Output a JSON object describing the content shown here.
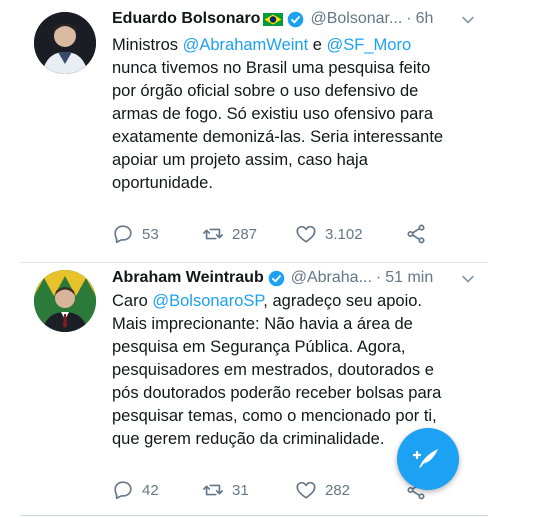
{
  "tweets": [
    {
      "name": "Eduardo Bolsonaro",
      "handle": "@Bolsonar...",
      "dot": "·",
      "time": "6h",
      "text_parts": [
        {
          "t": "Ministros "
        },
        {
          "t": "@AbrahamWeint",
          "mention": true
        },
        {
          "t": " e "
        },
        {
          "t": "@SF_Moro",
          "mention": true
        },
        {
          "t": "\nnunca tivemos no Brasil uma pesquisa feito\npor órgão oficial sobre o uso defensivo de\narmas de fogo. Só existiu uso ofensivo para\nexatamente demonizá-las. Seria interessante\napoiar um projeto assim, caso haja\noportunidade."
        }
      ],
      "replies": "53",
      "retweets": "287",
      "likes": "3.102",
      "avatar_icon": "avatar-photo",
      "flag_icon": "brazil-flag-icon"
    },
    {
      "name": "Abraham Weintraub",
      "handle": "@Abraha...",
      "dot": "·",
      "time": "51 min",
      "text_parts": [
        {
          "t": "Caro "
        },
        {
          "t": "@BolsonaroSP",
          "mention": true
        },
        {
          "t": ", agradeço seu apoio.\nMais imprecionante: Não havia a área de\npesquisa em Segurança Pública. Agora,\npesquisadores em mestrados, doutorados e\npós doutorados poderão receber bolsas para\npesquisar temas, como o mencionado por ti,\nque gerem redução da criminalidade."
        }
      ],
      "replies": "42",
      "retweets": "31",
      "likes": "282",
      "avatar_icon": "avatar-photo"
    }
  ],
  "colors": {
    "accent": "#1da1f2",
    "text": "#14171a",
    "secondary": "#657786",
    "divider": "#e1e8ed"
  },
  "fab_icon": "compose-tweet-icon"
}
